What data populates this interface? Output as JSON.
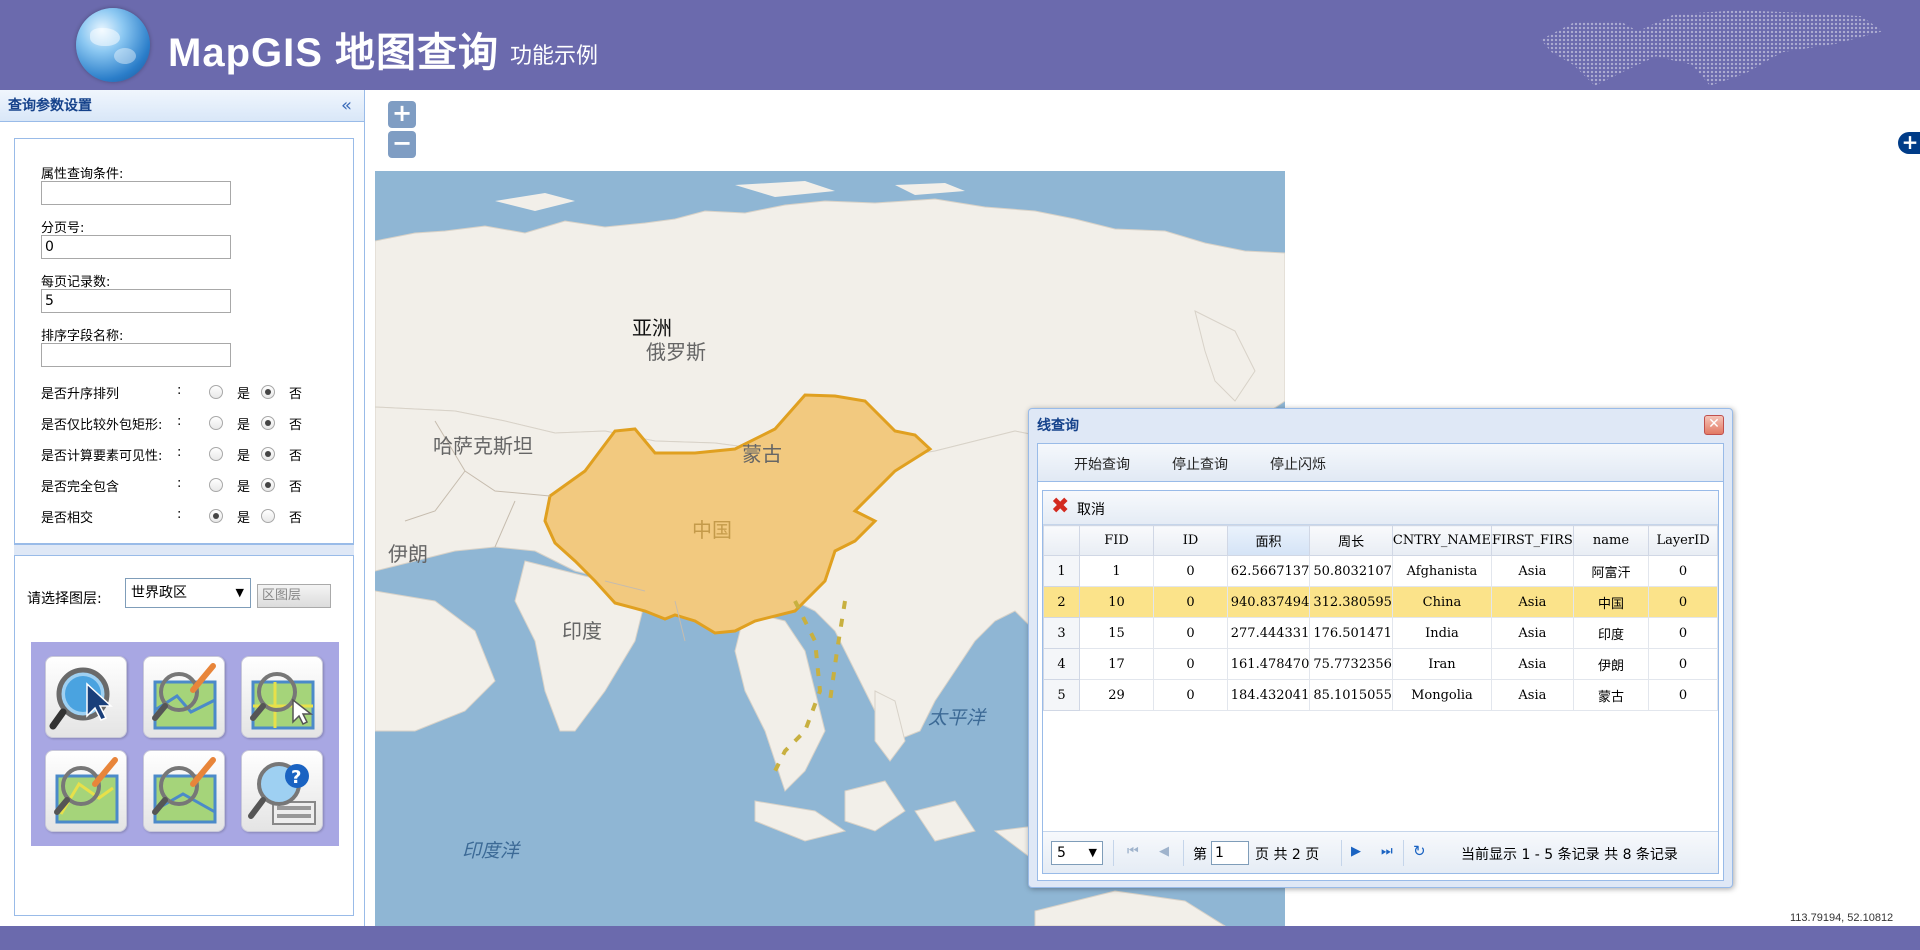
{
  "header": {
    "title": "MapGIS 地图查询",
    "subtitle": "功能示例"
  },
  "left_panel": {
    "title": "查询参数设置",
    "fields": [
      {
        "label": "属性查询条件:",
        "value": ""
      },
      {
        "label": "分页号:",
        "value": "0"
      },
      {
        "label": "每页记录数:",
        "value": "5"
      },
      {
        "label": "排序字段名称:",
        "value": ""
      }
    ],
    "options": [
      {
        "label": "是否升序排列",
        "selected": "否"
      },
      {
        "label": "是否仅比较外包矩形:",
        "selected": "否"
      },
      {
        "label": "是否计算要素可见性:",
        "selected": "否"
      },
      {
        "label": "是否完全包含",
        "selected": "否"
      },
      {
        "label": "是否相交",
        "selected": "是"
      }
    ],
    "colon": ":",
    "yes": "是",
    "no": "否",
    "layer_label": "请选择图层:",
    "layer_value": "世界政区",
    "layer_button": "区图层"
  },
  "map": {
    "labels": [
      "亚洲",
      "俄罗斯",
      "哈萨克斯坦",
      "蒙古",
      "中国",
      "伊朗",
      "印度"
    ],
    "oceans": [
      "太平洋",
      "印度洋"
    ],
    "zoom_in": "+",
    "zoom_out": "−",
    "coords": "113.79194, 52.10812"
  },
  "dialog": {
    "title": "线查询",
    "buttons": [
      "开始查询",
      "停止查询",
      "停止闪烁"
    ],
    "cancel": "取消",
    "columns": [
      "FID",
      "ID",
      "面积",
      "周长",
      "CNTRY_NAME",
      "FIRST_FIRS",
      "name",
      "LayerID"
    ],
    "rows": [
      [
        "1",
        "1",
        "0",
        "62.5667137",
        "50.8032107",
        "Afghanista",
        "Asia",
        "阿富汗",
        "0"
      ],
      [
        "2",
        "10",
        "0",
        "940.837494",
        "312.380595",
        "China",
        "Asia",
        "中国",
        "0"
      ],
      [
        "3",
        "15",
        "0",
        "277.444331",
        "176.501471",
        "India",
        "Asia",
        "印度",
        "0"
      ],
      [
        "4",
        "17",
        "0",
        "161.478470",
        "75.7732356",
        "Iran",
        "Asia",
        "伊朗",
        "0"
      ],
      [
        "5",
        "29",
        "0",
        "184.432041",
        "85.1015055",
        "Mongolia",
        "Asia",
        "蒙古",
        "0"
      ]
    ],
    "selected_row": 2,
    "pager": {
      "page_size": "5",
      "page_prefix": "第",
      "page": "1",
      "page_suffix": "页 共 2 页",
      "summary": "当前显示 1 - 5 条记录 共 8 条记录"
    }
  },
  "colors": {
    "header_bg": "#6b6aad",
    "china_fill": "#f2c97f",
    "china_stroke": "#e0a020",
    "selected_row": "#fbe38a",
    "ocean": "#8fb6d4",
    "land": "#f2efe9"
  }
}
